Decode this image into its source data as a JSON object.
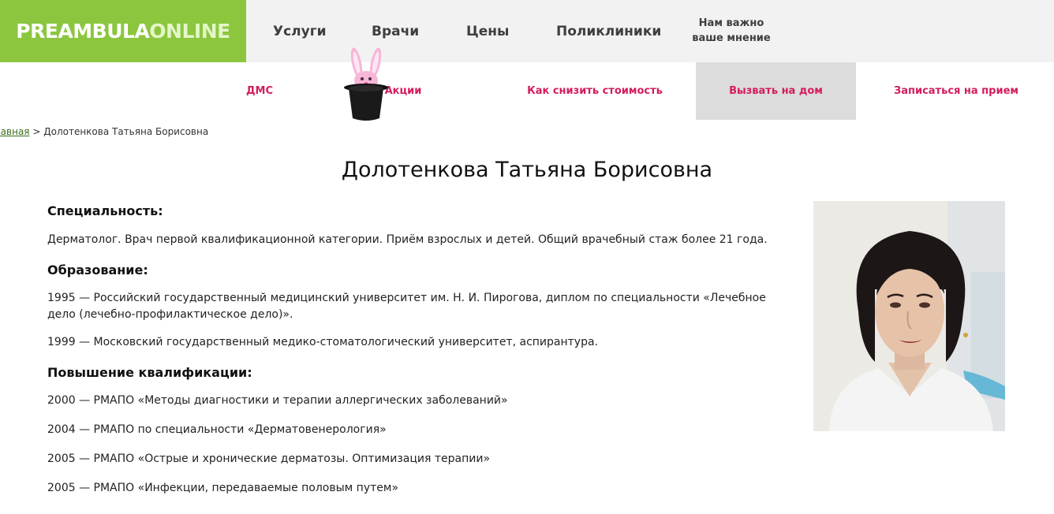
{
  "logo": {
    "part1": "PREAMBULA",
    "part2": "ONLINE"
  },
  "main_nav": [
    "Услуги",
    "Врачи",
    "Цены",
    "Поликлиники"
  ],
  "feedback": {
    "line1": "Нам важно",
    "line2": "ваше мнение"
  },
  "sub_nav": [
    "ДМС",
    "Акции",
    "Как снизить стоимость",
    "Вызвать на дом",
    "Записаться на прием"
  ],
  "breadcrumb": {
    "home": "лавная",
    "separator": ">",
    "current": "Долотенкова Татьяна Борисовна"
  },
  "doctor": {
    "name": "Долотенкова Татьяна Борисовна",
    "specialty_heading": "Специальность:",
    "specialty_text": "Дерматолог. Врач первой квалификационной категории. Приём взрослых и детей. Общий врачебный стаж более 21 года.",
    "education_heading": "Образование:",
    "education": [
      "1995 — Российский государственный медицинский университет им. Н. И. Пирогова, диплом по специальности «Лечебное дело (лечебно-профилактическое дело)».",
      "1999 — Московский государственный медико-стоматологический университет, аспирантура."
    ],
    "qualification_heading": "Повышение квалификации:",
    "qualification": [
      "2000 — РМАПО «Методы диагностики и терапии аллергических заболеваний»",
      "2004 — РМАПО по специальности «Дерматовенерология»",
      "2005 — РМАПО «Острые и хронические дерматозы. Оптимизация терапии»",
      "2005 — РМАПО «Инфекции, передаваемые половым путем»"
    ]
  },
  "colors": {
    "brand_green": "#8cc63f",
    "accent_pink": "#d31d5f",
    "active_bg": "#dcdcdc"
  }
}
